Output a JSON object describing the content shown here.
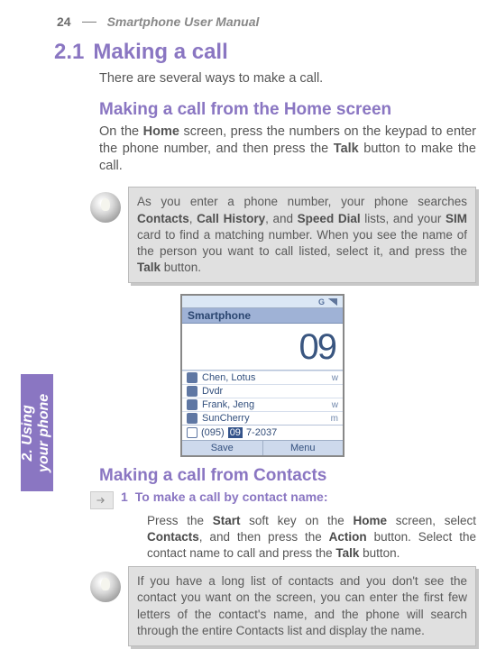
{
  "page_number": "24",
  "manual_title": "Smartphone User Manual",
  "side_tab_line1": "2. Using",
  "side_tab_line2": "your phone",
  "section_number": "2.1",
  "section_title": "Making a call",
  "intro": "There are several ways to make a call.",
  "sub1": "Making a call from the Home screen",
  "sub1_body_pre": "On the ",
  "sub1_body_b1": "Home",
  "sub1_body_mid": " screen, press the numbers on the keypad to enter the phone number, and then press the ",
  "sub1_body_b2": "Talk",
  "sub1_body_post": " button to make the call.",
  "tip1_pre": "As you enter a phone number, your phone searches ",
  "tip1_b1": "Contacts",
  "tip1_c1": ", ",
  "tip1_b2": "Call History",
  "tip1_c2": ", and ",
  "tip1_b3": "Speed Dial",
  "tip1_c3": " lists, and your ",
  "tip1_b4": "SIM",
  "tip1_c4": " card to find a matching number. When you see the name of the person you want to call listed, select it, and press the ",
  "tip1_b5": "Talk",
  "tip1_post": " button.",
  "ss": {
    "title": "Smartphone",
    "big": "09",
    "rows": [
      {
        "name": "Chen, Lotus",
        "type": "w"
      },
      {
        "name": "Dvdr",
        "type": ""
      },
      {
        "name": "Frank, Jeng",
        "type": "w"
      },
      {
        "name": "SunCherry",
        "type": "m"
      }
    ],
    "num_prefix": "(095) ",
    "num_sel": "09",
    "num_rest": "7-2037",
    "left": "Save",
    "right": "Menu"
  },
  "sub2": "Making a call from Contacts",
  "step_num": "1",
  "step_title": "To make a call by contact name:",
  "step_body_pre": "Press the ",
  "step_b1": "Start",
  "step_c1": " soft key on the ",
  "step_b2": "Home",
  "step_c2": " screen, select ",
  "step_b3": "Contacts",
  "step_c3": ", and then press the ",
  "step_b4": "Action",
  "step_c4": " button. Select the contact name to call and press the ",
  "step_b5": "Talk",
  "step_post": " button.",
  "tip2": "If you have a long list of contacts and you don't see the contact you want on the screen, you can enter the first few letters of the contact's name, and the phone will search through the entire Contacts list and display the name."
}
